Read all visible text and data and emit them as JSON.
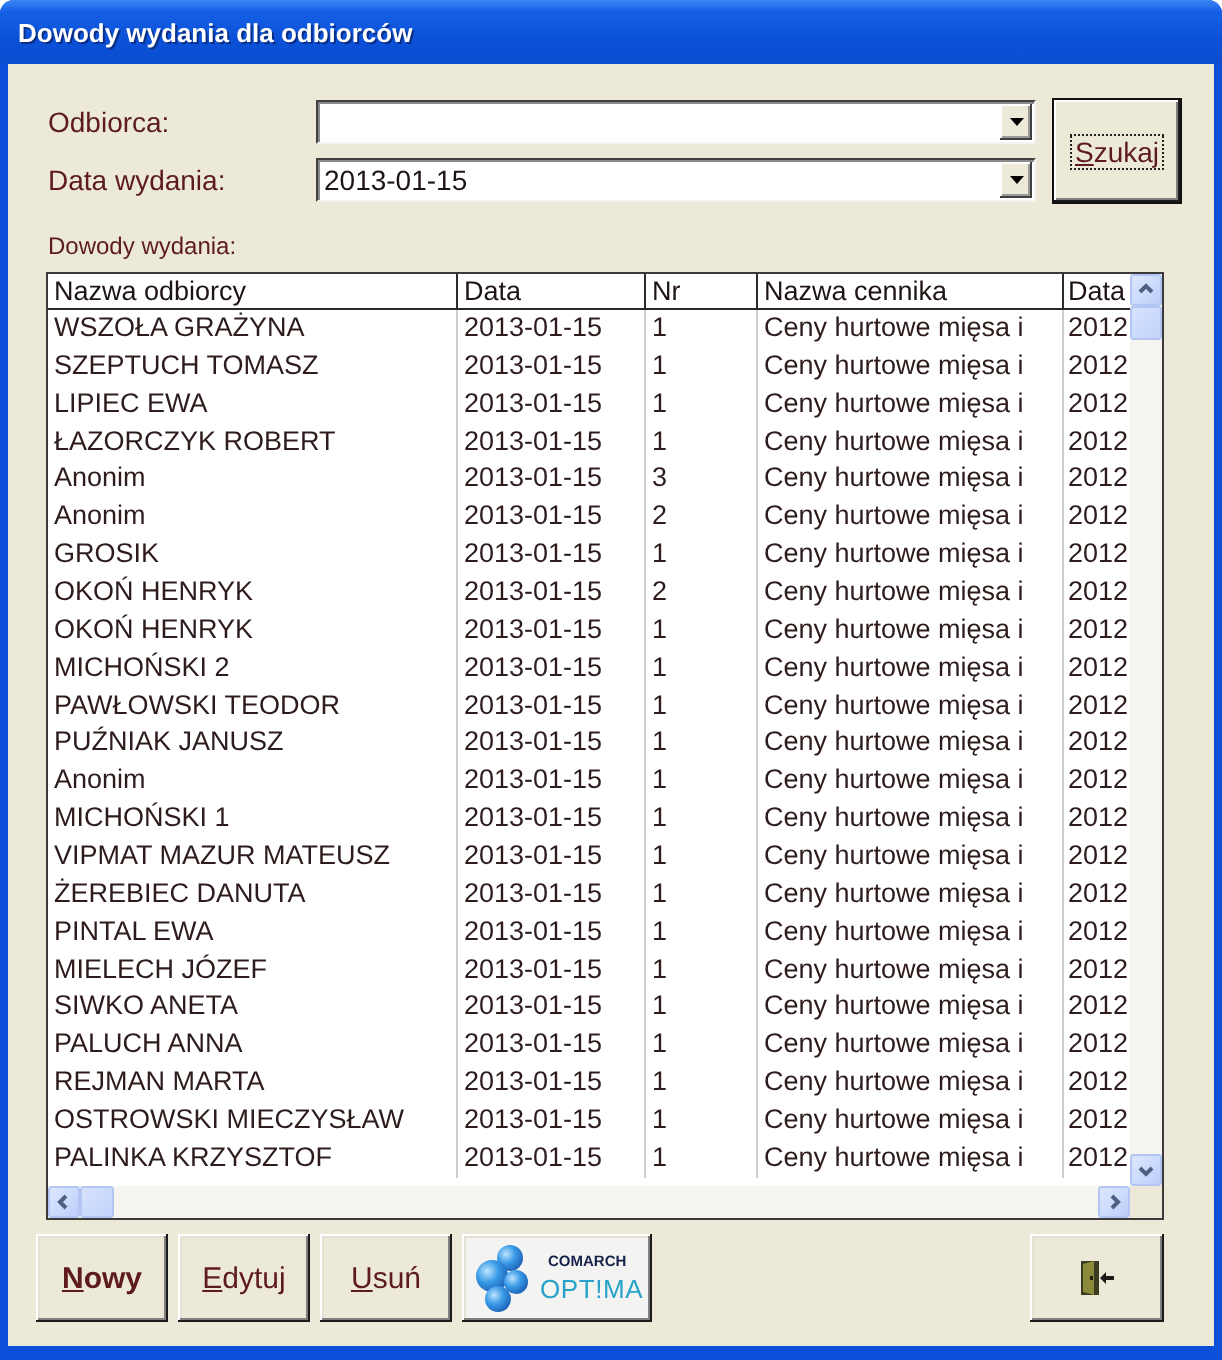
{
  "window": {
    "title": "Dowody wydania dla odbiorców"
  },
  "filters": [
    {
      "label": "Odbiorca:"
    },
    {
      "label": "Data wydania:",
      "value": "2013-01-15"
    }
  ],
  "search_button": {
    "label": "Szukaj",
    "focused": true
  },
  "list_label": "Dowody wydania:",
  "table": {
    "columns": [
      "Nazwa odbiorcy",
      "Data",
      "Nr",
      "Nazwa cennika",
      "Data"
    ],
    "rows": [
      [
        "WSZOŁA GRAŻYNA",
        "2013-01-15",
        "1",
        "Ceny hurtowe mięsa i",
        "2012"
      ],
      [
        "SZEPTUCH TOMASZ",
        "2013-01-15",
        "1",
        "Ceny hurtowe mięsa i",
        "2012"
      ],
      [
        "LIPIEC EWA",
        "2013-01-15",
        "1",
        "Ceny hurtowe mięsa i",
        "2012"
      ],
      [
        "ŁAZORCZYK ROBERT",
        "2013-01-15",
        "1",
        "Ceny hurtowe mięsa i",
        "2012"
      ],
      [
        "Anonim",
        "2013-01-15",
        "3",
        "Ceny hurtowe mięsa i",
        "2012"
      ],
      [
        "Anonim",
        "2013-01-15",
        "2",
        "Ceny hurtowe mięsa i",
        "2012"
      ],
      [
        "GROSIK",
        "2013-01-15",
        "1",
        "Ceny hurtowe mięsa i",
        "2012"
      ],
      [
        "OKOŃ HENRYK",
        "2013-01-15",
        "2",
        "Ceny hurtowe mięsa i",
        "2012"
      ],
      [
        "OKOŃ HENRYK",
        "2013-01-15",
        "1",
        "Ceny hurtowe mięsa i",
        "2012"
      ],
      [
        "MICHOŃSKI 2",
        "2013-01-15",
        "1",
        "Ceny hurtowe mięsa i",
        "2012"
      ],
      [
        "PAWŁOWSKI TEODOR",
        "2013-01-15",
        "1",
        "Ceny hurtowe mięsa i",
        "2012"
      ],
      [
        "PUŹNIAK JANUSZ",
        "2013-01-15",
        "1",
        "Ceny hurtowe mięsa i",
        "2012"
      ],
      [
        "Anonim",
        "2013-01-15",
        "1",
        "Ceny hurtowe mięsa i",
        "2012"
      ],
      [
        "MICHOŃSKI 1",
        "2013-01-15",
        "1",
        "Ceny hurtowe mięsa i",
        "2012"
      ],
      [
        "VIPMAT MAZUR MATEUSZ",
        "2013-01-15",
        "1",
        "Ceny hurtowe mięsa i",
        "2012"
      ],
      [
        "ŻEREBIEC DANUTA",
        "2013-01-15",
        "1",
        "Ceny hurtowe mięsa i",
        "2012"
      ],
      [
        "PINTAL EWA",
        "2013-01-15",
        "1",
        "Ceny hurtowe mięsa i",
        "2012"
      ],
      [
        "MIELECH JÓZEF",
        "2013-01-15",
        "1",
        "Ceny hurtowe mięsa i",
        "2012"
      ],
      [
        "SIWKO ANETA",
        "2013-01-15",
        "1",
        "Ceny hurtowe mięsa i",
        "2012"
      ],
      [
        "PALUCH ANNA",
        "2013-01-15",
        "1",
        "Ceny hurtowe mięsa i",
        "2012"
      ],
      [
        "REJMAN MARTA",
        "2013-01-15",
        "1",
        "Ceny hurtowe mięsa i",
        "2012"
      ],
      [
        "OSTROWSKI MIECZYSŁAW",
        "2013-01-15",
        "1",
        "Ceny hurtowe mięsa i",
        "2012"
      ],
      [
        "PALINKA KRZYSZTOF",
        "2013-01-15",
        "1",
        "Ceny hurtowe mięsa i",
        "2012"
      ]
    ]
  },
  "buttons": [
    {
      "kind": "text",
      "label": "Nowy",
      "default": true
    },
    {
      "kind": "text",
      "label": "Edytuj",
      "default": false
    },
    {
      "kind": "text",
      "label": "Usuń",
      "default": false
    },
    {
      "kind": "logo",
      "brand": "COMARCH",
      "product": "OPT!MA"
    },
    {
      "kind": "exit"
    }
  ]
}
